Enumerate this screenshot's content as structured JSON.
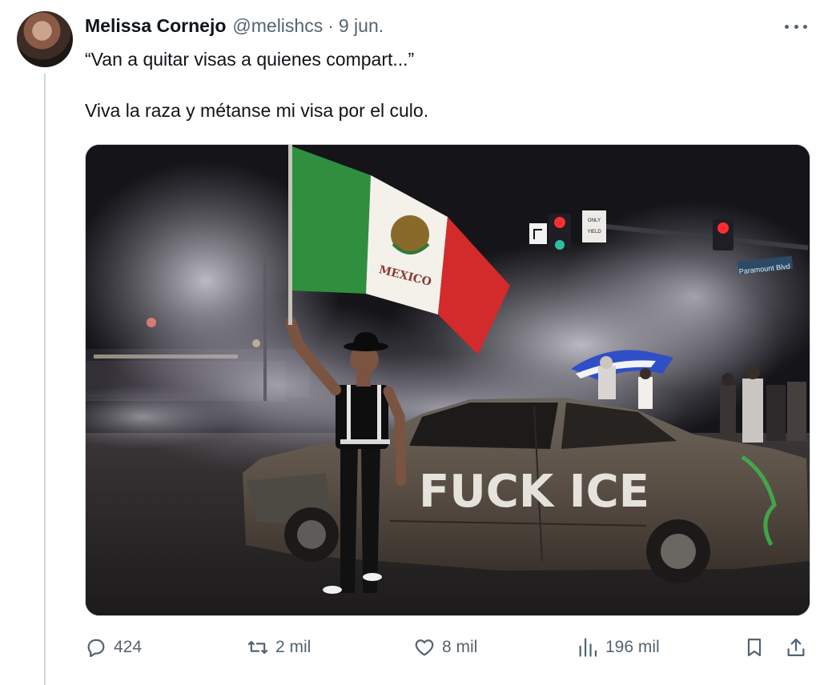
{
  "tweet": {
    "author_name": "Melissa Cornejo",
    "handle": "@melishcs",
    "separator": "·",
    "date": "9 jun.",
    "text": "“Van a quitar visas a quienes compart...”\n\nViva la raza y métanse mi visa por el culo.",
    "more_icon": "more-horizontal-icon"
  },
  "media": {
    "flag_text": "MEXICO",
    "graffiti_text": "FUCK ICE",
    "street_sign": "Paramount Blvd",
    "lane_sign_1": "ONLY",
    "lane_sign_2": "YIELD"
  },
  "actions": {
    "reply_count": "424",
    "retweet_count": "2 mil",
    "like_count": "8 mil",
    "view_count": "196 mil"
  },
  "colors": {
    "text_primary": "#0f1419",
    "text_secondary": "#536471",
    "border": "#cfd9de",
    "flag_green": "#2e8b3e",
    "flag_red": "#d32b2b"
  }
}
